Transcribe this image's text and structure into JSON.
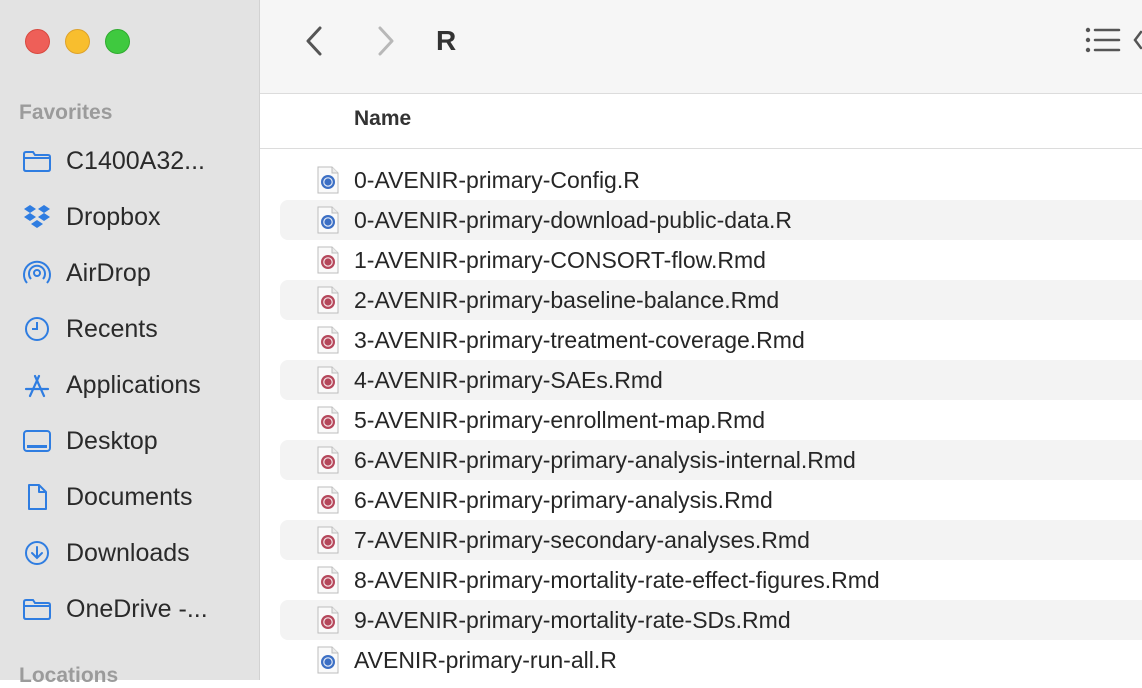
{
  "window": {
    "title": "R"
  },
  "sidebar": {
    "favorites_title": "Favorites",
    "locations_title": "Locations",
    "items": [
      {
        "label": "C1400A32...",
        "icon": "folder-icon"
      },
      {
        "label": "Dropbox",
        "icon": "dropbox-icon"
      },
      {
        "label": "AirDrop",
        "icon": "airdrop-icon"
      },
      {
        "label": "Recents",
        "icon": "clock-icon"
      },
      {
        "label": "Applications",
        "icon": "applications-icon"
      },
      {
        "label": "Desktop",
        "icon": "desktop-icon"
      },
      {
        "label": "Documents",
        "icon": "document-icon"
      },
      {
        "label": "Downloads",
        "icon": "download-icon"
      },
      {
        "label": "OneDrive -...",
        "icon": "folder-icon"
      }
    ]
  },
  "columns": {
    "name": "Name"
  },
  "files": [
    {
      "name": "0-AVENIR-primary-Config.R",
      "type": "R"
    },
    {
      "name": "0-AVENIR-primary-download-public-data.R",
      "type": "R"
    },
    {
      "name": "1-AVENIR-primary-CONSORT-flow.Rmd",
      "type": "Rmd"
    },
    {
      "name": "2-AVENIR-primary-baseline-balance.Rmd",
      "type": "Rmd"
    },
    {
      "name": "3-AVENIR-primary-treatment-coverage.Rmd",
      "type": "Rmd"
    },
    {
      "name": "4-AVENIR-primary-SAEs.Rmd",
      "type": "Rmd"
    },
    {
      "name": "5-AVENIR-primary-enrollment-map.Rmd",
      "type": "Rmd"
    },
    {
      "name": "6-AVENIR-primary-primary-analysis-internal.Rmd",
      "type": "Rmd"
    },
    {
      "name": "6-AVENIR-primary-primary-analysis.Rmd",
      "type": "Rmd"
    },
    {
      "name": "7-AVENIR-primary-secondary-analyses.Rmd",
      "type": "Rmd"
    },
    {
      "name": "8-AVENIR-primary-mortality-rate-effect-figures.Rmd",
      "type": "Rmd"
    },
    {
      "name": "9-AVENIR-primary-mortality-rate-SDs.Rmd",
      "type": "Rmd"
    },
    {
      "name": "AVENIR-primary-run-all.R",
      "type": "R"
    }
  ],
  "colors": {
    "accent": "#2f7de1",
    "rmd_badge": "#b5475b",
    "r_badge": "#3c6fc4"
  }
}
